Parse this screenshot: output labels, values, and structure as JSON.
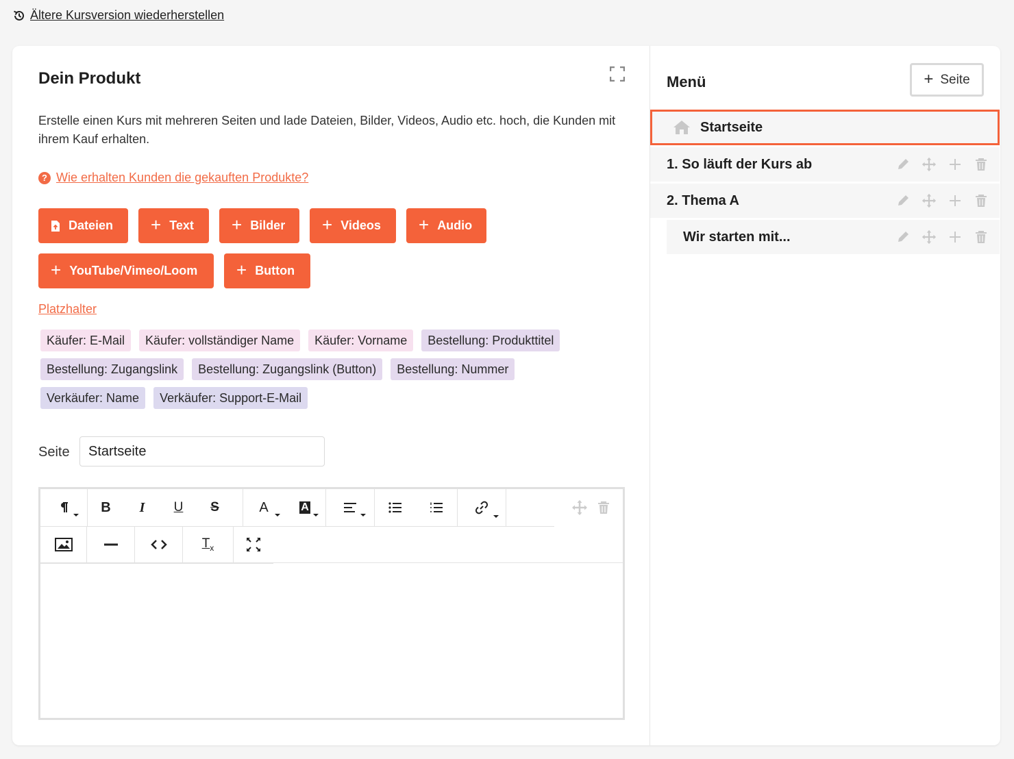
{
  "top_link": {
    "label": "Ältere Kursversion wiederherstellen",
    "icon": "history-icon"
  },
  "product": {
    "title": "Dein Produkt",
    "description": "Erstelle einen Kurs mit mehreren Seiten und lade Dateien, Bilder, Videos, Audio etc. hoch, die Kunden mit ihrem Kauf erhalten.",
    "help_link": "Wie erhalten Kunden die gekauften Produkte?"
  },
  "add_buttons": {
    "dateien": "Dateien",
    "text": "Text",
    "bilder": "Bilder",
    "videos": "Videos",
    "audio": "Audio",
    "embed": "YouTube/Vimeo/Loom",
    "button": "Button"
  },
  "placeholders": {
    "link": "Platzhalter",
    "chips": [
      "Käufer: E-Mail",
      "Käufer: vollständiger Name",
      "Käufer: Vorname",
      "Bestellung: Produkttitel",
      "Bestellung: Zugangslink",
      "Bestellung: Zugangslink (Button)",
      "Bestellung: Nummer",
      "Verkäufer: Name",
      "Verkäufer: Support-E-Mail"
    ]
  },
  "page_field": {
    "label": "Seite",
    "value": "Startseite"
  },
  "menu": {
    "title": "Menü",
    "add_page": "Seite",
    "items": [
      {
        "label": "Startseite"
      },
      {
        "label": "1. So läuft der Kurs ab"
      },
      {
        "label": "2. Thema A"
      },
      {
        "label": "Wir starten mit..."
      }
    ]
  },
  "colors": {
    "accent": "#f4623a",
    "link": "#f26b46",
    "chip_pink": "#f7e1ef",
    "chip_violet": "#e4d9ee",
    "chip_lavender": "#dcd9ef"
  }
}
